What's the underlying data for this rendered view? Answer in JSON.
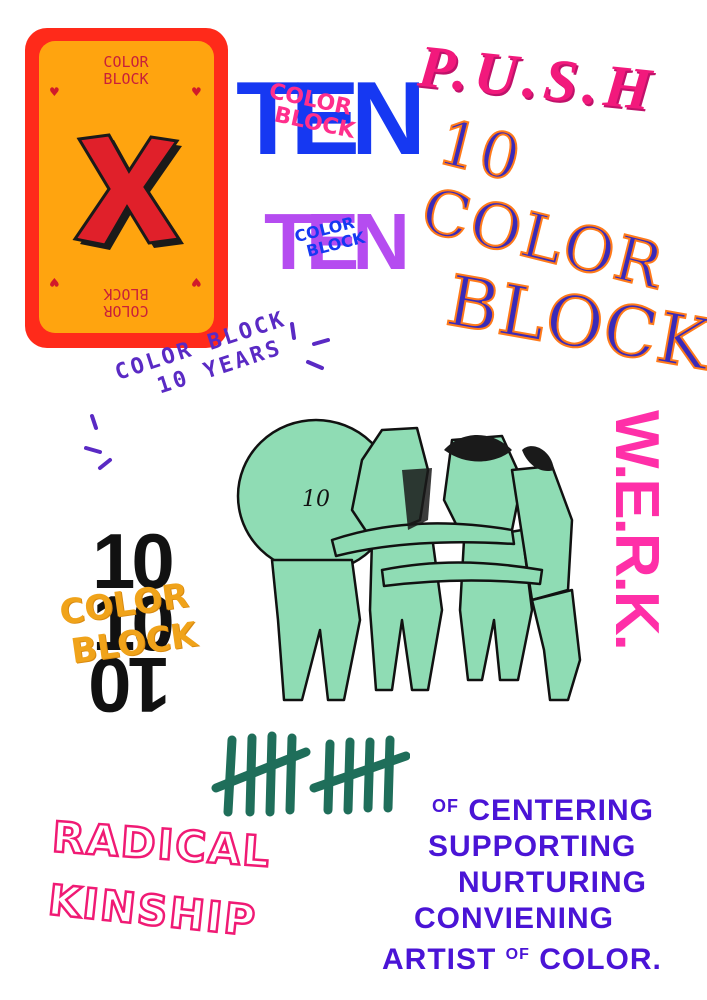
{
  "card": {
    "top_line1": "COLOR",
    "top_line2": "BLOCK",
    "big_mark": "X",
    "bottom_line1": "COLOR",
    "bottom_line2": "BLOCK",
    "colors": {
      "outer": "#ff2a1a",
      "inner": "#ffa40f",
      "mark": "#e0202a"
    }
  },
  "ten_big": {
    "word": "TEN",
    "script1": "COLOR",
    "script2": "BLOCK",
    "color": "#1638f2",
    "script_color": "#ff2f8c"
  },
  "ten_small": {
    "word": "TEN",
    "script1": "COLOR",
    "script2": "BLOCK",
    "color": "#b54cf0",
    "script_color": "#1638f2"
  },
  "push": {
    "text": "P.U.S.H"
  },
  "ten_color_block": {
    "line1": "10 COLOR",
    "line2": "BLOCK"
  },
  "years": {
    "line1": "COLOR BLOCK",
    "line2": "10 YEARS"
  },
  "illustration": {
    "label": "10",
    "figure_color": "#8fdcb4"
  },
  "stacked_ten": {
    "number": "10",
    "script1": "COLOR",
    "script2": "BLOCK"
  },
  "werk": {
    "text": "W.E.R.K."
  },
  "tally": {
    "color": "#1f6e5a"
  },
  "radical": {
    "line1": "RADICAL",
    "line2": "KINSHIP"
  },
  "credo": {
    "line1_small": "OF",
    "line1": "CENTERING",
    "line2": "SUPPORTING",
    "line3": "NURTURING",
    "line4": "CONVIENING",
    "line5a": "ARTIST",
    "line5_small": "OF",
    "line5b": "COLOR."
  }
}
